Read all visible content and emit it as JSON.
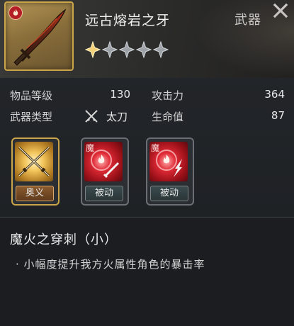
{
  "item": {
    "name": "远古熔岩之牙",
    "type": "武器",
    "stars_filled": 1,
    "stars_total": 5
  },
  "stats": {
    "item_level_label": "物品等级",
    "item_level_value": "130",
    "attack_label": "攻击力",
    "attack_value": "364",
    "weapon_type_label": "武器类型",
    "weapon_type_value": "太刀",
    "hp_label": "生命值",
    "hp_value": "87"
  },
  "skills": [
    {
      "label": "奥义",
      "kind": "gold"
    },
    {
      "label": "被动",
      "kind": "red",
      "mark": "魔"
    },
    {
      "label": "被动",
      "kind": "red",
      "mark": "魔"
    }
  ],
  "selected_skill": {
    "name": "魔火之穿刺（小）",
    "description": "· 小幅度提升我方火属性角色的暴击率"
  },
  "colors": {
    "gold": "#caa54a",
    "fire_red": "#c0202a"
  },
  "icons": {
    "close": "close-icon",
    "star": "star-icon",
    "weapon_type": "crossed-swords-icon"
  }
}
